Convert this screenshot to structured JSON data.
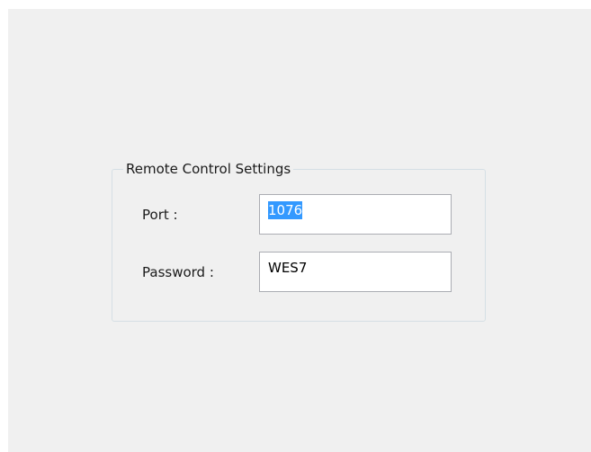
{
  "group": {
    "title": "Remote Control Settings"
  },
  "port": {
    "label": "Port :",
    "value": "1076"
  },
  "password": {
    "label": "Password :",
    "value": "WES7"
  },
  "colors": {
    "selection": "#3399ff",
    "panel": "#f0f0f0",
    "group_border": "#d5dfe5"
  }
}
